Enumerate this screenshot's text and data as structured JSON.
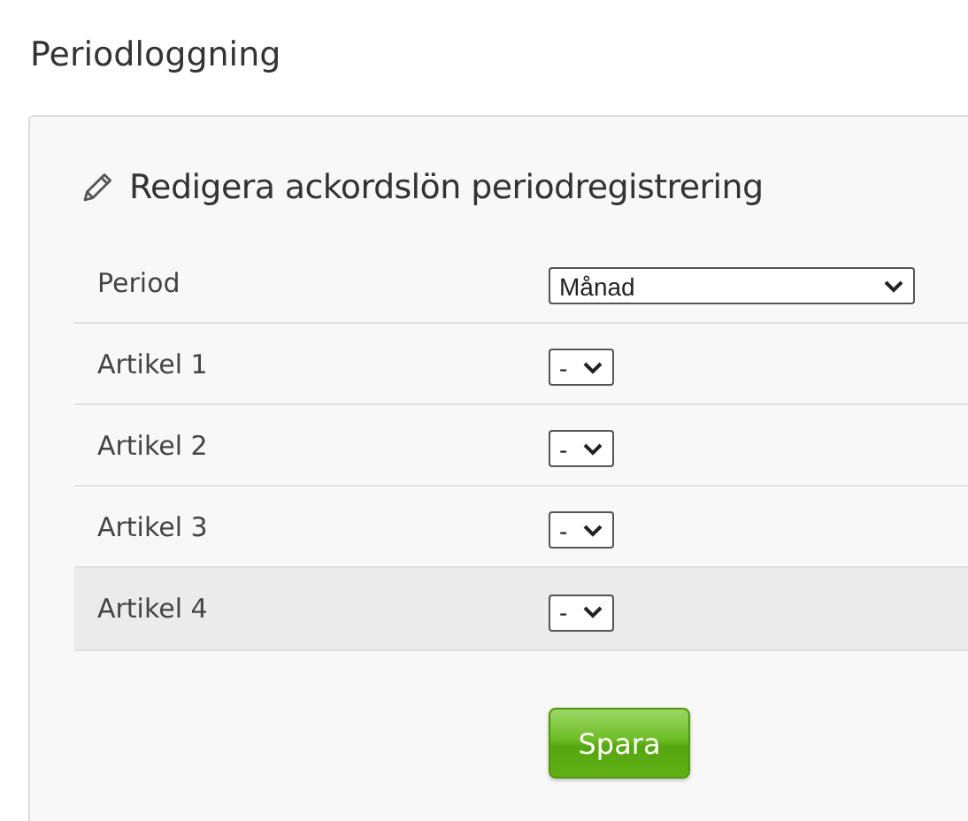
{
  "page_title": "Periodloggning",
  "panel": {
    "heading": "Redigera ackordslön periodregistrering",
    "rows": [
      {
        "label": "Period",
        "value": "Månad",
        "kind": "wide",
        "highlighted": false
      },
      {
        "label": "Artikel 1",
        "value": "-",
        "kind": "narrow",
        "highlighted": false
      },
      {
        "label": "Artikel 2",
        "value": "-",
        "kind": "narrow",
        "highlighted": false
      },
      {
        "label": "Artikel 3",
        "value": "-",
        "kind": "narrow",
        "highlighted": false
      },
      {
        "label": "Artikel 4",
        "value": "-",
        "kind": "narrow",
        "highlighted": true
      }
    ],
    "save_button": "Spara"
  }
}
